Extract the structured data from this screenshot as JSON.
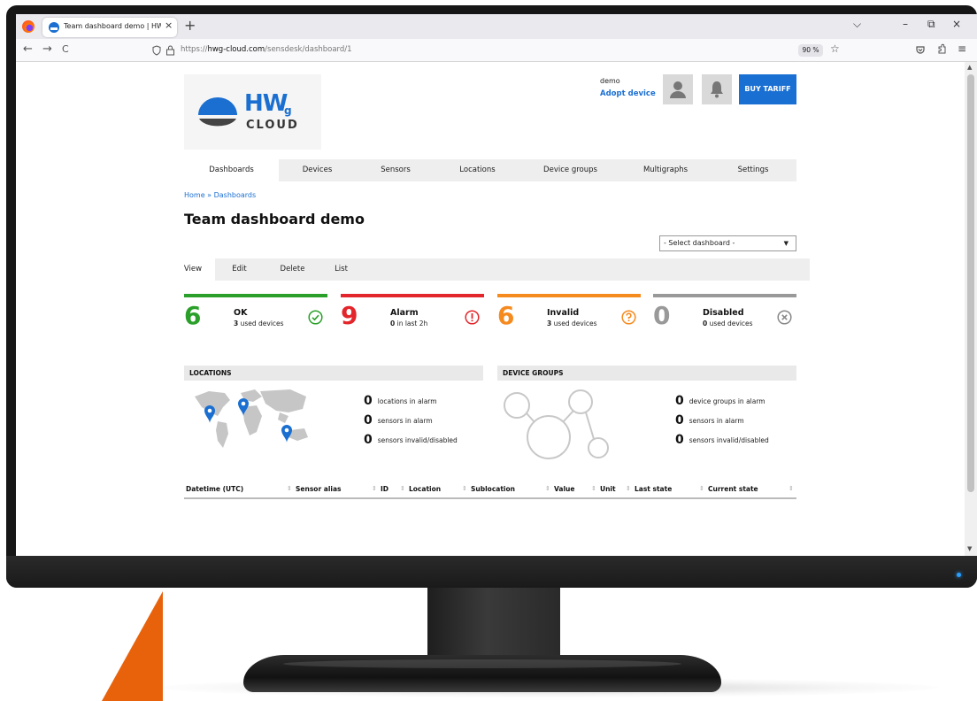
{
  "browser": {
    "tab_title": "Team dashboard demo | HWg-",
    "tab_close": "×",
    "new_tab": "+",
    "url_prefix": "https://",
    "url_host": "hwg-cloud.com",
    "url_path": "/sensdesk/dashboard/1",
    "zoom": "90 %",
    "back": "←",
    "forward": "→",
    "reload": "C",
    "minimize": "–",
    "restore": "⧉",
    "close": "×",
    "menu": "≡"
  },
  "header": {
    "logo_brand": "HW",
    "logo_sub": "g",
    "logo_cloud": "CLOUD",
    "user_name": "demo",
    "adopt_link": "Adopt device",
    "buy_button": "BUY TARIFF"
  },
  "main_nav": [
    "Dashboards",
    "Devices",
    "Sensors",
    "Locations",
    "Device groups",
    "Multigraphs",
    "Settings"
  ],
  "breadcrumb": "Home » Dashboards",
  "page_title": "Team dashboard demo",
  "select_dashboard": "- Select dashboard -",
  "sub_tabs": [
    "View",
    "Edit",
    "Delete",
    "List"
  ],
  "stats": [
    {
      "count": "6",
      "label": "OK",
      "sub_bold": "3",
      "sub_text": "used devices",
      "color": "#2aa02a",
      "icon": "check-circle-icon"
    },
    {
      "count": "9",
      "label": "Alarm",
      "sub_bold": "0",
      "sub_text": "in last 2h",
      "color": "#e3262b",
      "icon": "exclamation-circle-icon"
    },
    {
      "count": "6",
      "label": "Invalid",
      "sub_bold": "3",
      "sub_text": "used devices",
      "color": "#f58a1f",
      "icon": "question-circle-icon"
    },
    {
      "count": "0",
      "label": "Disabled",
      "sub_bold": "0",
      "sub_text": "used devices",
      "color": "#999999",
      "icon": "x-circle-icon"
    }
  ],
  "locations": {
    "title": "LOCATIONS",
    "lines": [
      {
        "n": "0",
        "text": "locations in alarm"
      },
      {
        "n": "0",
        "text": "sensors in alarm"
      },
      {
        "n": "0",
        "text": "sensors invalid/disabled"
      }
    ]
  },
  "device_groups": {
    "title": "DEVICE GROUPS",
    "lines": [
      {
        "n": "0",
        "text": "device groups in alarm"
      },
      {
        "n": "0",
        "text": "sensors in alarm"
      },
      {
        "n": "0",
        "text": "sensors invalid/disabled"
      }
    ]
  },
  "table_columns": [
    "Datetime (UTC)",
    "Sensor alias",
    "ID",
    "Location",
    "Sublocation",
    "Value",
    "Unit",
    "Last state",
    "Current state"
  ],
  "colors": {
    "accent": "#1a6fd3",
    "ok": "#2aa02a",
    "alarm": "#e3262b",
    "invalid": "#f58a1f",
    "disabled": "#999999",
    "wedge": "#e8620c"
  }
}
